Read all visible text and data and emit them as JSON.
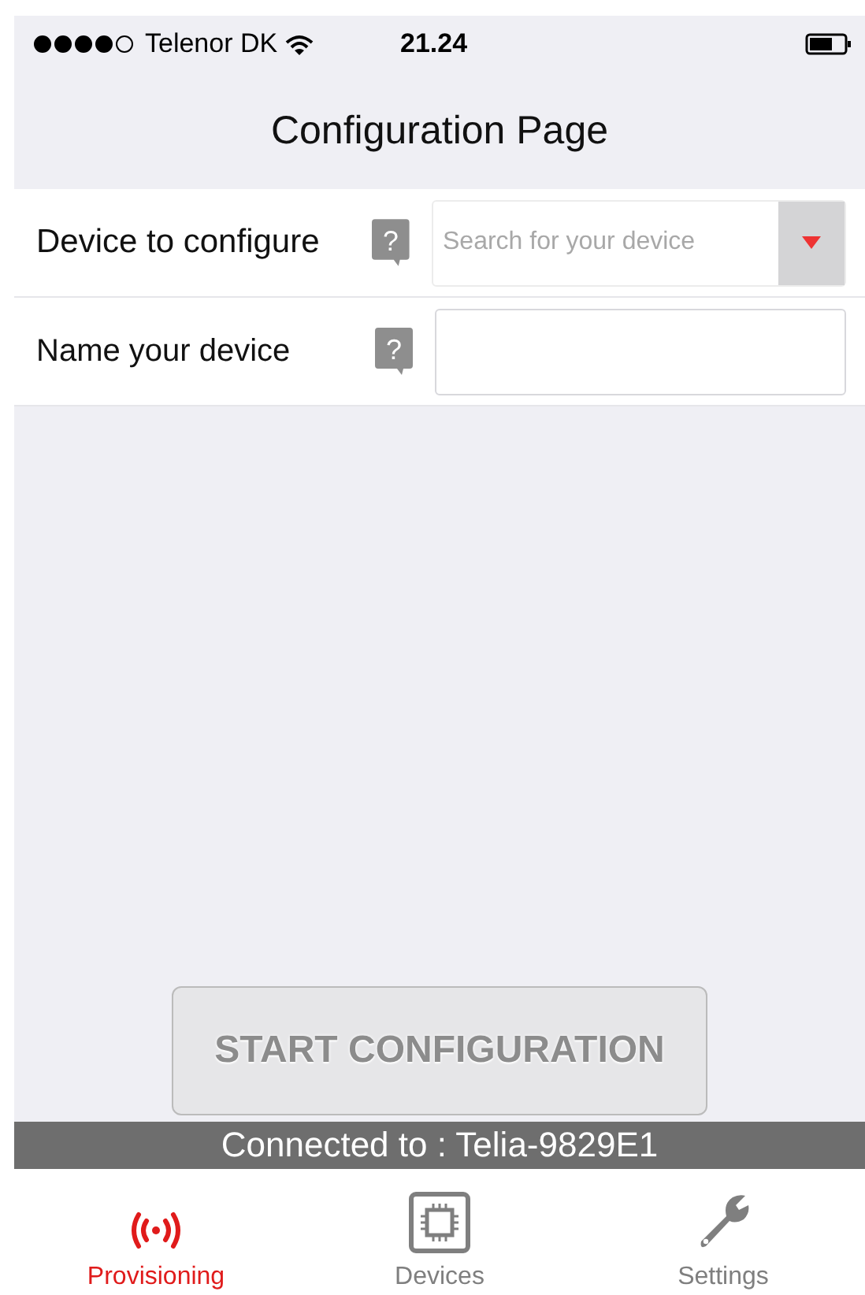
{
  "status_bar": {
    "carrier": "Telenor DK",
    "time": "21.24"
  },
  "nav_bar": {
    "title": "Configuration Page"
  },
  "form_rows": [
    {
      "kind": "dropdown",
      "label": "Device to configure",
      "help": "?",
      "placeholder": "Search for your device"
    },
    {
      "kind": "text",
      "label": "Name your device",
      "help": "?"
    }
  ],
  "start_button": {
    "label": "START CONFIGURATION",
    "disabled": true
  },
  "connection_banner": "Connected to : Telia-9829E1",
  "tabs": [
    {
      "label": "Provisioning",
      "selected": true
    },
    {
      "label": "Devices",
      "selected": false
    },
    {
      "label": "Settings",
      "selected": false
    }
  ]
}
